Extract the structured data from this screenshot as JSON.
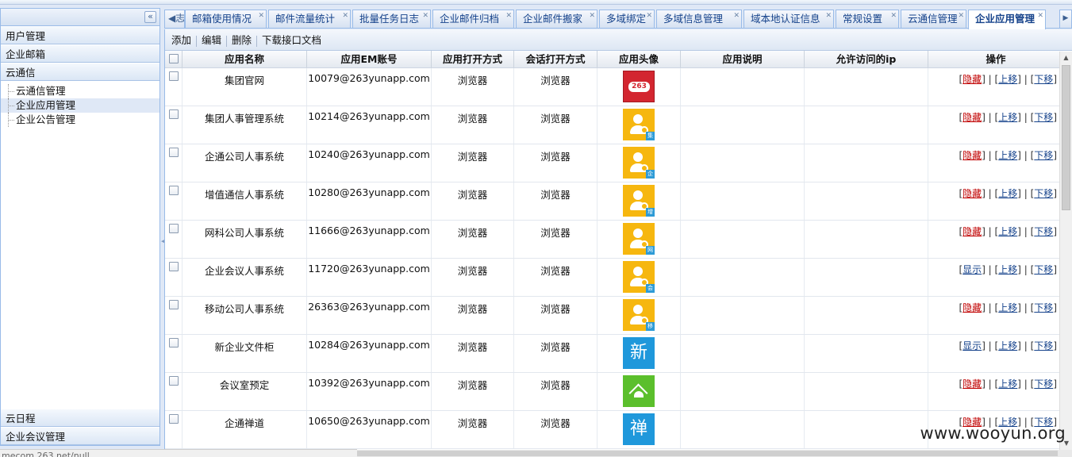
{
  "sidebar": {
    "collapse_icon": "double-chevron-left-icon",
    "sections": [
      "用户管理",
      "企业邮箱",
      "云通信"
    ],
    "tree": [
      {
        "label": "云通信管理",
        "selected": false
      },
      {
        "label": "企业应用管理",
        "selected": true
      },
      {
        "label": "企业公告管理",
        "selected": false
      }
    ],
    "bottom_sections": [
      "云日程",
      "企业会议管理"
    ]
  },
  "tabs": {
    "scroll_left_label": "志",
    "items": [
      {
        "label": "邮箱使用情况",
        "active": false
      },
      {
        "label": "邮件流量统计",
        "active": false
      },
      {
        "label": "批量任务日志",
        "active": false
      },
      {
        "label": "企业邮件归档",
        "active": false
      },
      {
        "label": "企业邮件搬家",
        "active": false
      },
      {
        "label": "多域绑定",
        "active": false
      },
      {
        "label": "多域信息管理",
        "active": false
      },
      {
        "label": "域本地认证信息",
        "active": false
      },
      {
        "label": "常规设置",
        "active": false
      },
      {
        "label": "云通信管理",
        "active": false
      },
      {
        "label": "企业应用管理",
        "active": true
      }
    ],
    "close_glyph": "✕"
  },
  "toolbar": {
    "add": "添加",
    "edit": "编辑",
    "delete": "删除",
    "download": "下载接口文档"
  },
  "grid": {
    "columns": [
      "应用名称",
      "应用EM账号",
      "应用打开方式",
      "会话打开方式",
      "应用头像",
      "应用说明",
      "允许访问的ip",
      "操作"
    ],
    "rows": [
      {
        "name": "集团官网",
        "account": "10079@263yunapp.com",
        "open": "浏览器",
        "session": "浏览器",
        "avatar": "red",
        "badge": "263",
        "desc": "",
        "ip": "",
        "toggle": "隐藏",
        "up": "上移",
        "down": "下移"
      },
      {
        "name": "集团人事管理系统",
        "account": "10214@263yunapp.com",
        "open": "浏览器",
        "session": "浏览器",
        "avatar": "yellow",
        "badge": "集",
        "desc": "",
        "ip": "",
        "toggle": "隐藏",
        "up": "上移",
        "down": "下移"
      },
      {
        "name": "企通公司人事系统",
        "account": "10240@263yunapp.com",
        "open": "浏览器",
        "session": "浏览器",
        "avatar": "yellow",
        "badge": "企",
        "desc": "",
        "ip": "",
        "toggle": "隐藏",
        "up": "上移",
        "down": "下移"
      },
      {
        "name": "增值通信人事系统",
        "account": "10280@263yunapp.com",
        "open": "浏览器",
        "session": "浏览器",
        "avatar": "yellow",
        "badge": "增",
        "desc": "",
        "ip": "",
        "toggle": "隐藏",
        "up": "上移",
        "down": "下移"
      },
      {
        "name": "网科公司人事系统",
        "account": "11666@263yunapp.com",
        "open": "浏览器",
        "session": "浏览器",
        "avatar": "yellow",
        "badge": "网",
        "desc": "",
        "ip": "",
        "toggle": "隐藏",
        "up": "上移",
        "down": "下移"
      },
      {
        "name": "企业会议人事系统",
        "account": "11720@263yunapp.com",
        "open": "浏览器",
        "session": "浏览器",
        "avatar": "yellow",
        "badge": "会",
        "desc": "",
        "ip": "",
        "toggle": "显示",
        "up": "上移",
        "down": "下移"
      },
      {
        "name": "移动公司人事系统",
        "account": "26363@263yunapp.com",
        "open": "浏览器",
        "session": "浏览器",
        "avatar": "yellow",
        "badge": "移",
        "desc": "",
        "ip": "",
        "toggle": "隐藏",
        "up": "上移",
        "down": "下移"
      },
      {
        "name": "新企业文件柜",
        "account": "10284@263yunapp.com",
        "open": "浏览器",
        "session": "浏览器",
        "avatar": "blue",
        "badge": "新",
        "desc": "",
        "ip": "",
        "toggle": "显示",
        "up": "上移",
        "down": "下移"
      },
      {
        "name": "会议室预定",
        "account": "10392@263yunapp.com",
        "open": "浏览器",
        "session": "浏览器",
        "avatar": "green",
        "badge": "",
        "desc": "",
        "ip": "",
        "toggle": "隐藏",
        "up": "上移",
        "down": "下移"
      },
      {
        "name": "企通禅道",
        "account": "10650@263yunapp.com",
        "open": "浏览器",
        "session": "浏览器",
        "avatar": "blue",
        "badge": "禅",
        "desc": "",
        "ip": "",
        "toggle": "隐藏",
        "up": "上移",
        "down": "下移"
      }
    ]
  },
  "status": {
    "url_fragment": "mecom.263.net/null"
  },
  "watermark": "www.wooyun.org",
  "colors": {
    "accent": "#15428b",
    "hide_link": "#c00000",
    "border": "#99bbe8"
  }
}
